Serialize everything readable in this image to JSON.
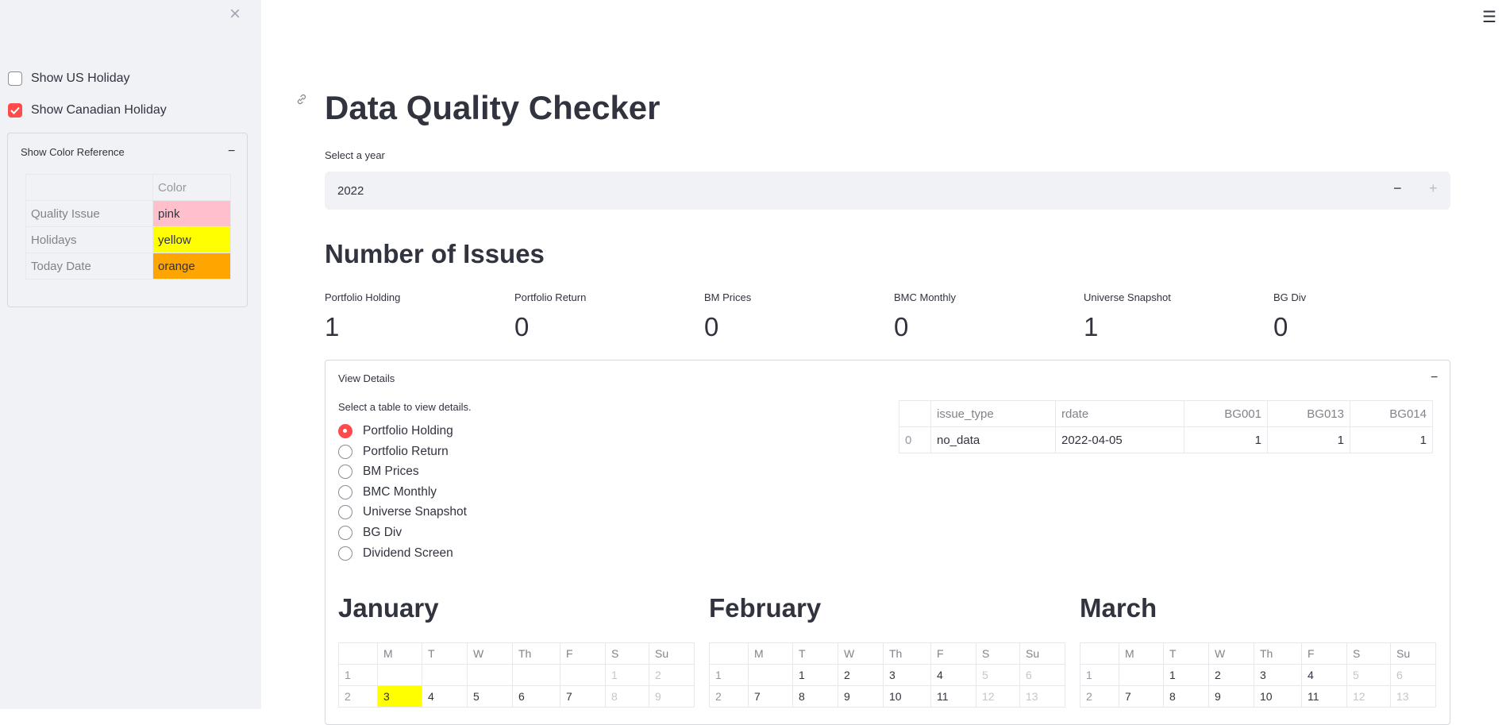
{
  "sidebar": {
    "close_glyph": "×",
    "checkboxes": [
      {
        "label": "Show US Holiday",
        "checked": false
      },
      {
        "label": "Show Canadian Holiday",
        "checked": true
      }
    ],
    "color_reference": {
      "title": "Show Color Reference",
      "toggle": "−",
      "column_header": "Color",
      "rows": [
        {
          "label": "Quality Issue",
          "value": "pink",
          "color": "#ffc0cb"
        },
        {
          "label": "Holidays",
          "value": "yellow",
          "color": "#ffff00"
        },
        {
          "label": "Today Date",
          "value": "orange",
          "color": "#ffa500"
        }
      ]
    }
  },
  "header": {
    "menu_glyph": "☰"
  },
  "main": {
    "title": "Data Quality Checker",
    "year_label": "Select a year",
    "year_value": "2022",
    "minus": "−",
    "plus": "+",
    "issues_heading": "Number of Issues",
    "metrics": [
      {
        "label": "Portfolio Holding",
        "value": "1"
      },
      {
        "label": "Portfolio Return",
        "value": "0"
      },
      {
        "label": "BM Prices",
        "value": "0"
      },
      {
        "label": "BMC Monthly",
        "value": "0"
      },
      {
        "label": "Universe Snapshot",
        "value": "1"
      },
      {
        "label": "BG Div",
        "value": "0"
      }
    ],
    "details": {
      "title": "View Details",
      "toggle": "−",
      "radio_label": "Select a table to view details.",
      "options": [
        "Portfolio Holding",
        "Portfolio Return",
        "BM Prices",
        "BMC Monthly",
        "Universe Snapshot",
        "BG Div",
        "Dividend Screen"
      ],
      "selected_index": 0,
      "table": {
        "headers": [
          "",
          "issue_type",
          "rdate",
          "BG001",
          "BG013",
          "BG014"
        ],
        "rows": [
          [
            "0",
            "no_data",
            "2022-04-05",
            "1",
            "1",
            "1"
          ]
        ]
      }
    },
    "calendar": {
      "day_headers": [
        "",
        "M",
        "T",
        "W",
        "Th",
        "F",
        "S",
        "Su"
      ],
      "months": [
        {
          "name": "January",
          "rows": [
            [
              "1",
              "",
              "",
              "",
              "",
              "",
              "1",
              "2"
            ],
            [
              "2",
              "3",
              "4",
              "5",
              "6",
              "7",
              "8",
              "9"
            ]
          ],
          "holiday": "3"
        },
        {
          "name": "February",
          "rows": [
            [
              "1",
              "",
              "1",
              "2",
              "3",
              "4",
              "5",
              "6"
            ],
            [
              "2",
              "7",
              "8",
              "9",
              "10",
              "11",
              "12",
              "13"
            ]
          ],
          "holiday": ""
        },
        {
          "name": "March",
          "rows": [
            [
              "1",
              "",
              "1",
              "2",
              "3",
              "4",
              "5",
              "6"
            ],
            [
              "2",
              "7",
              "8",
              "9",
              "10",
              "11",
              "12",
              "13"
            ]
          ],
          "holiday": ""
        }
      ]
    }
  }
}
